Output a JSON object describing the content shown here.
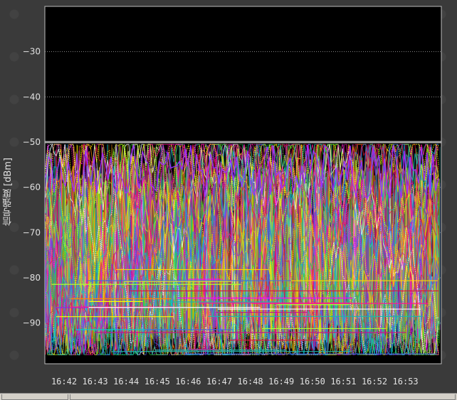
{
  "chart_data": {
    "type": "line",
    "title": "",
    "xlabel": "",
    "ylabel": "信号强度 [dBm]",
    "ylim": [
      -99,
      -20
    ],
    "yticks": [
      -30,
      -40,
      -50,
      -60,
      -70,
      -80,
      -90
    ],
    "xticks": [
      "16:42",
      "16:43",
      "16:44",
      "16:45",
      "16:46",
      "16:47",
      "16:48",
      "16:49",
      "16:50",
      "16:51",
      "16:52",
      "16:53"
    ],
    "grid": true,
    "background": "#000000",
    "grid_color": "#8a8a8a",
    "series_colors": [
      "#8a2be2",
      "#c71585",
      "#ff1493",
      "#dc143c",
      "#ffd700",
      "#ffff00",
      "#32cd32",
      "#00ced1",
      "#1e90ff",
      "#ff8c00",
      "#adff2f",
      "#ff00ff",
      "#4169e1",
      "#ffffff",
      "#9acd32",
      "#20b2aa"
    ],
    "series_count": "many (dense multi-series signal traces)",
    "ceiling_line_value": -50
  }
}
